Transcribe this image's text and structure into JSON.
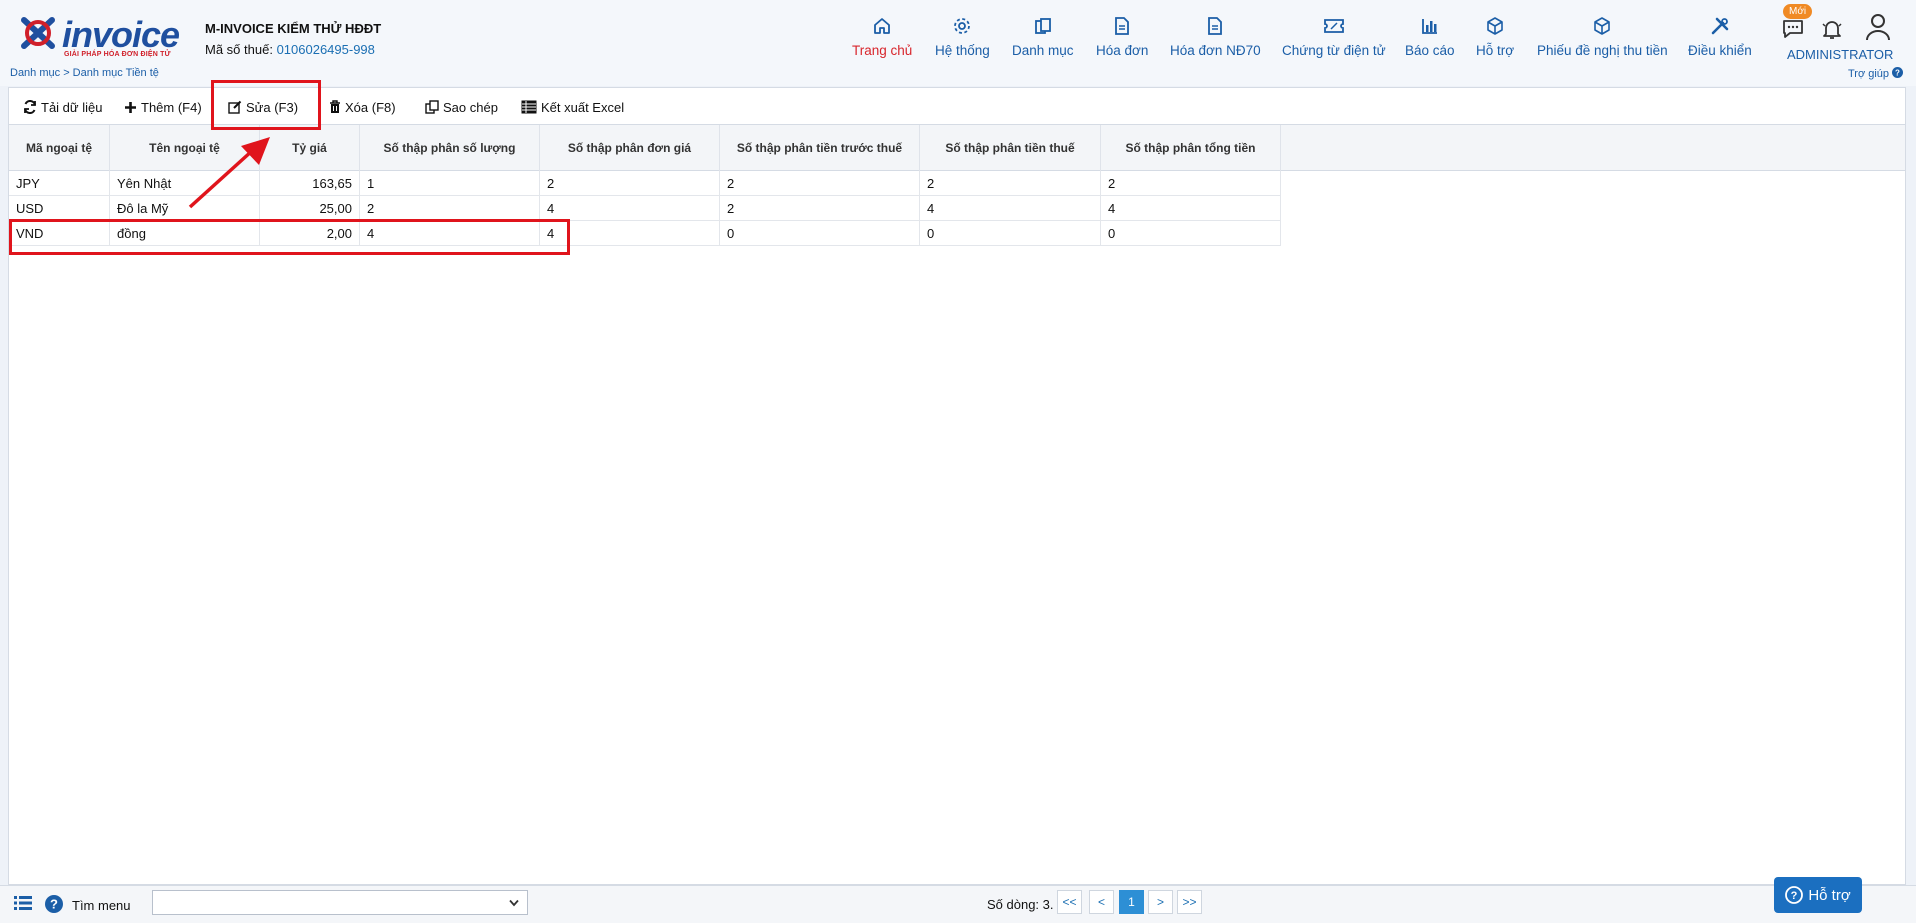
{
  "header": {
    "logo_text": "invoice",
    "logo_sub": "GIẢI PHÁP HÓA ĐƠN ĐIỆN TỬ",
    "company": "M-INVOICE KIỂM THỬ HĐĐT",
    "tax_label": "Mã số thuế:",
    "tax_value": "0106026495-998",
    "breadcrumb": "Danh mục > Danh mục Tiền tệ",
    "nav": [
      {
        "label": "Trang chủ",
        "icon": "home-icon"
      },
      {
        "label": "Hệ thống",
        "icon": "gear-icon"
      },
      {
        "label": "Danh mục",
        "icon": "copy-icon"
      },
      {
        "label": "Hóa đơn",
        "icon": "document-icon"
      },
      {
        "label": "Hóa đơn NĐ70",
        "icon": "document-icon"
      },
      {
        "label": "Chứng từ điện tử",
        "icon": "ticket-icon"
      },
      {
        "label": "Báo cáo",
        "icon": "bar-chart-icon"
      },
      {
        "label": "Hỗ trợ",
        "icon": "cube-icon"
      },
      {
        "label": "Phiếu đề nghị thu tiền",
        "icon": "cube-icon"
      },
      {
        "label": "Điều khiển",
        "icon": "tools-icon"
      }
    ],
    "badge_new": "Mới",
    "user": "ADMINISTRATOR",
    "help_link": "Trợ giúp"
  },
  "toolbar": {
    "reload": "Tải dữ liệu",
    "add": "Thêm (F4)",
    "edit": "Sửa (F3)",
    "delete": "Xóa (F8)",
    "copy": "Sao chép",
    "export": "Kết xuất Excel"
  },
  "grid": {
    "columns": [
      "Mã ngoại tệ",
      "Tên ngoại tệ",
      "Tỷ giá",
      "Số thập phân số lượng",
      "Số thập phân đơn giá",
      "Số thập phân tiền trước thuế",
      "Số thập phân tiền thuế",
      "Số thập phân tổng tiền"
    ],
    "rows": [
      [
        "JPY",
        "Yên Nhật",
        "163,65",
        "1",
        "2",
        "2",
        "2",
        "2"
      ],
      [
        "USD",
        "Đô la Mỹ",
        "25,00",
        "2",
        "4",
        "2",
        "4",
        "4"
      ],
      [
        "VND",
        "đồng",
        "2,00",
        "4",
        "4",
        "0",
        "0",
        "0"
      ]
    ]
  },
  "footer": {
    "menu_search_label": "Tìm menu",
    "row_count": "Số dòng: 3.",
    "pager": [
      "<<",
      "<",
      "1",
      ">",
      ">>"
    ],
    "support_button": "Hỗ trợ"
  },
  "colors": {
    "primary": "#1b5ea7",
    "active_nav": "#d8262c",
    "highlight": "#e0141c",
    "pager_active": "#2d8fd5",
    "badge": "#f08a24"
  }
}
